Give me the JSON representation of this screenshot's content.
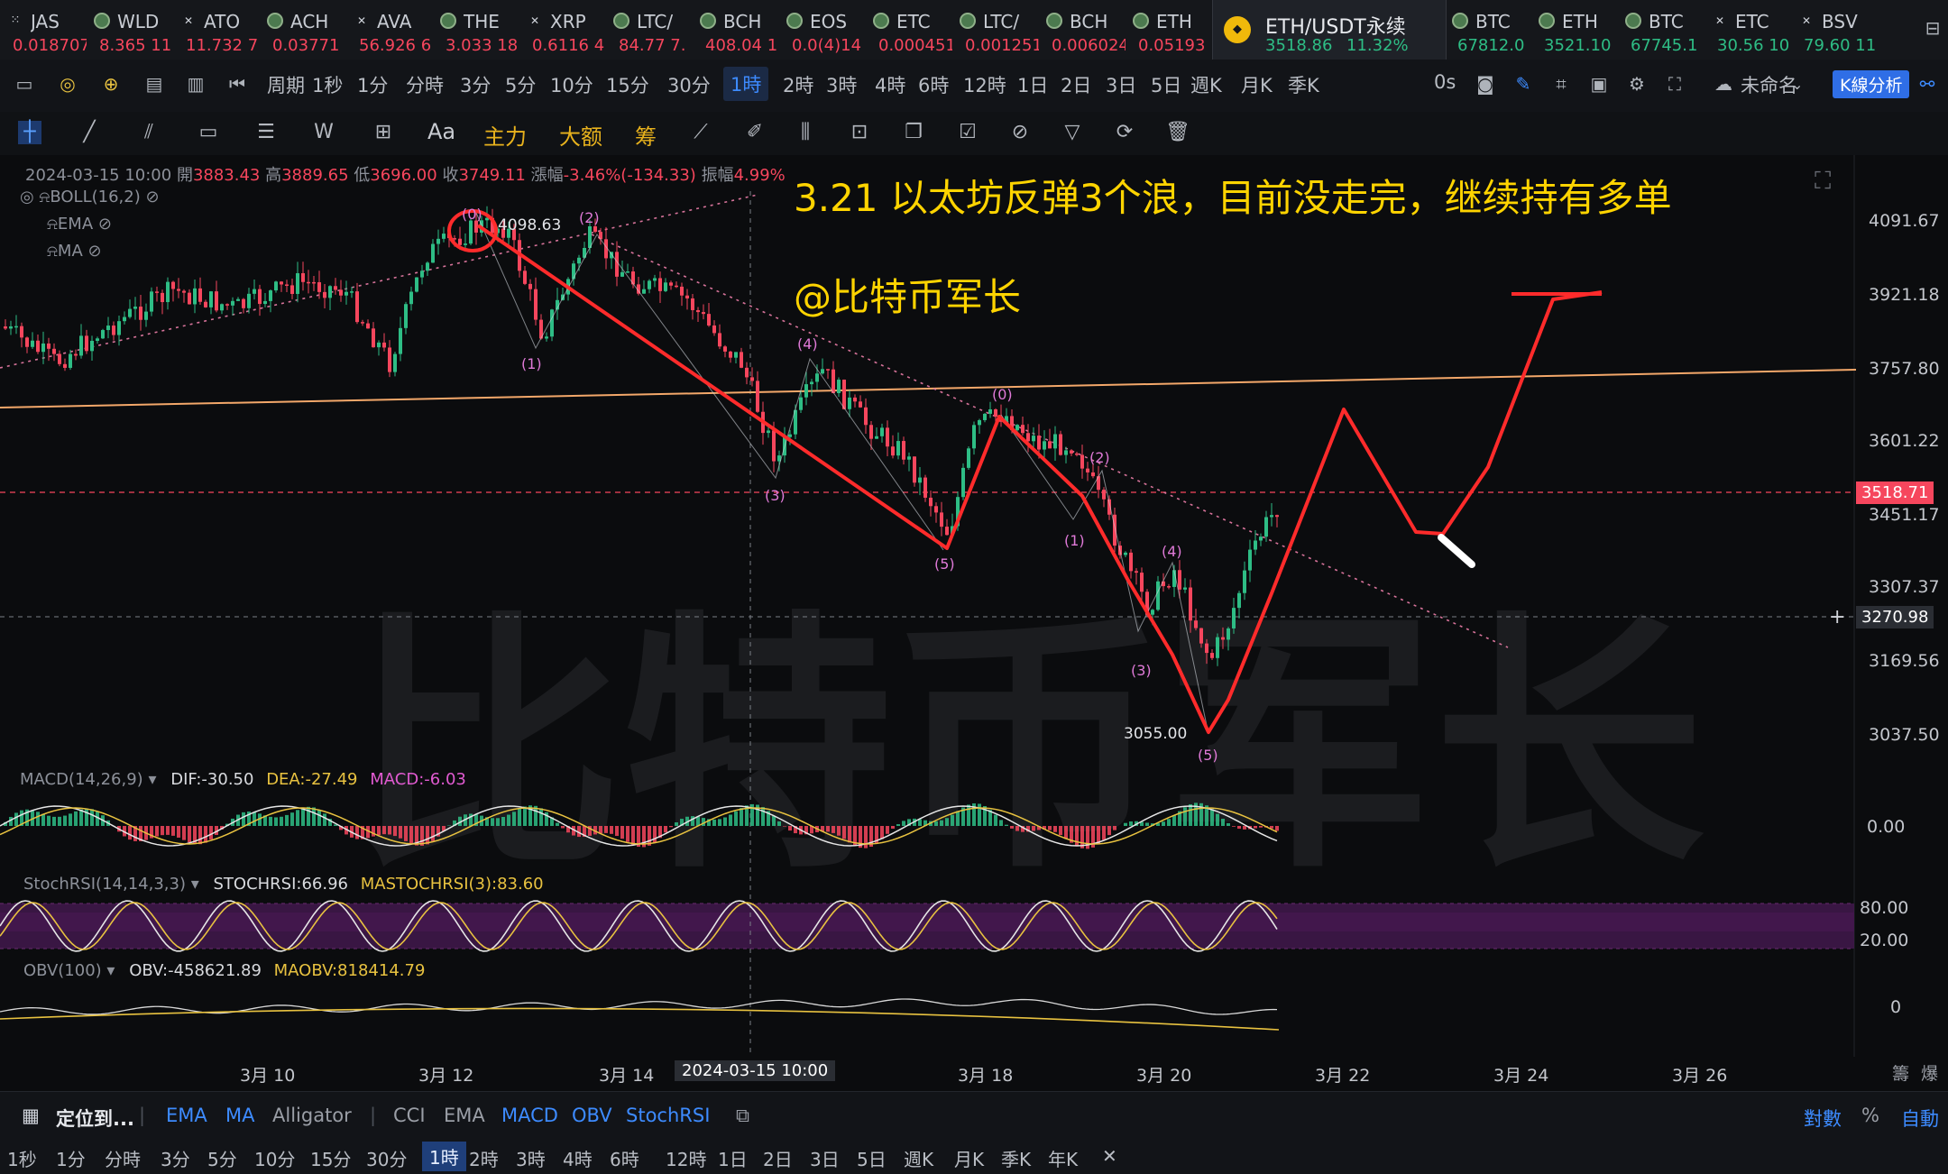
{
  "ticker_tabs": [
    {
      "symbol": "JAS",
      "price": "0.018707",
      "icon": "square-dots-icon"
    },
    {
      "symbol": "WLD",
      "price": "8.365 11",
      "icon": "coin-icon"
    },
    {
      "symbol": "ATO",
      "price": "11.732 7",
      "icon": "x-icon"
    },
    {
      "symbol": "ACH",
      "price": "0.03771",
      "icon": "coin-icon"
    },
    {
      "symbol": "AVA",
      "price": "56.926 6",
      "icon": "x-icon"
    },
    {
      "symbol": "THE",
      "price": "3.033 18",
      "icon": "coin-icon"
    },
    {
      "symbol": "XRP",
      "price": "0.6116 4",
      "icon": "x-icon"
    },
    {
      "symbol": "LTC/",
      "price": "84.77 7.",
      "icon": "coin-icon"
    },
    {
      "symbol": "BCH",
      "price": "408.04 1",
      "icon": "coin-icon"
    },
    {
      "symbol": "EOS",
      "price": "0.0(4)14",
      "icon": "coin-icon"
    },
    {
      "symbol": "ETC",
      "price": "0.000451",
      "icon": "coin-icon"
    },
    {
      "symbol": "LTC/",
      "price": "0.001251",
      "icon": "coin-icon"
    },
    {
      "symbol": "BCH",
      "price": "0.006024",
      "icon": "coin-icon"
    },
    {
      "symbol": "ETH",
      "price": "0.05193",
      "icon": "coin-icon"
    },
    {
      "symbol": "ETH/USDT永续",
      "price": "3518.86",
      "change": "11.32%",
      "icon": "binance-icon",
      "active": true
    },
    {
      "symbol": "BTC",
      "price": "67812.0",
      "icon": "coin-icon"
    },
    {
      "symbol": "ETH",
      "price": "3521.10",
      "icon": "coin-icon"
    },
    {
      "symbol": "BTC",
      "price": "67745.1",
      "icon": "coin-icon"
    },
    {
      "symbol": "ETC",
      "price": "30.56 10",
      "icon": "x-icon"
    },
    {
      "symbol": "BSV",
      "price": "79.60 11",
      "icon": "x-icon"
    }
  ],
  "timeframes": [
    "周期",
    "1秒",
    "1分",
    "分時",
    "3分",
    "5分",
    "10分",
    "15分",
    "30分",
    "1時",
    "2時",
    "3時",
    "4時",
    "6時",
    "12時",
    "1日",
    "2日",
    "3日",
    "5日",
    "週K",
    "月K",
    "季K"
  ],
  "selected_timeframe": "1時",
  "toolbar_right": {
    "countdown": "0s",
    "layout_name": "未命名",
    "kline_analysis": "K線分析"
  },
  "draw_tools": {
    "main": "主力",
    "big": "大额",
    "chip": "筹",
    "text": "Aa"
  },
  "ohlc": {
    "date": "2024-03-15 10:00",
    "open_label": "開",
    "open": "3883.43",
    "high_label": "高",
    "high": "3889.65",
    "low_label": "低",
    "low": "3696.00",
    "close_label": "收",
    "close": "3749.11",
    "chg_label": "漲幅",
    "chg": "-3.46%(-134.33)",
    "amp_label": "振幅",
    "amp": "4.99%"
  },
  "overlays": [
    "BOLL(16,2)",
    "EMA",
    "MA"
  ],
  "annotation": {
    "line1": "3.21 以太坊反弹3个浪，目前没走完，继续持有多单",
    "line2": "@比特币军长"
  },
  "watermark": "比特币军长",
  "price_axis": [
    "4091.67",
    "3921.18",
    "3757.80",
    "3601.22",
    "3451.17",
    "3307.37",
    "3169.56",
    "3037.50"
  ],
  "current_price": "3518.71",
  "crosshair_price": "3270.98",
  "crosshair_date": "2024-03-15 10:00",
  "high_mark": "4098.63",
  "low_mark": "3055.00",
  "date_axis": [
    "3月 10",
    "3月 12",
    "3月 14",
    "3月 18",
    "3月 20",
    "3月 22",
    "3月 24",
    "3月 26"
  ],
  "wave_labels": {
    "p0": "(0)",
    "p1": "(1)",
    "p2": "(2)",
    "p3": "(3)",
    "p4": "(4)",
    "p5": "(5)",
    "q0": "(0)",
    "q1": "(1)",
    "q2": "(2)",
    "q3": "(3)",
    "q4": "(4)",
    "q5": "(5)"
  },
  "macd": {
    "name": "MACD(14,26,9)",
    "dif": "DIF:-30.50",
    "dea": "DEA:-27.49",
    "macd": "MACD:-6.03",
    "zero": "0.00"
  },
  "stochrsi": {
    "name": "StochRSI(14,14,3,3)",
    "k": "STOCHRSI:66.96",
    "d": "MASTOCHRSI(3):83.60",
    "hi": "80.00",
    "lo": "20.00"
  },
  "obv": {
    "name": "OBV(100)",
    "obv": "OBV:-458621.89",
    "ma": "MAOBV:818414.79",
    "zero": "0"
  },
  "chart_right_top": {
    "a": "籌",
    "b": "爆"
  },
  "indicator_bar": {
    "locate": "定位到...",
    "items": [
      "EMA",
      "MA",
      "Alligator",
      "CCI",
      "EMA",
      "MACD",
      "OBV",
      "StochRSI"
    ],
    "log": "對數",
    "pct": "%",
    "auto": "自動"
  },
  "bottom_timeframes": [
    "1秒",
    "1分",
    "分時",
    "3分",
    "5分",
    "10分",
    "15分",
    "30分",
    "1時",
    "2時",
    "3時",
    "4時",
    "6時",
    "12時",
    "1日",
    "2日",
    "3日",
    "5日",
    "週K",
    "月K",
    "季K",
    "年K"
  ],
  "colors": {
    "up": "#2ebd85",
    "down": "#f6465d",
    "accent": "#3d8bff",
    "annotation": "#ffd400",
    "draw": "#ff2b2b"
  }
}
